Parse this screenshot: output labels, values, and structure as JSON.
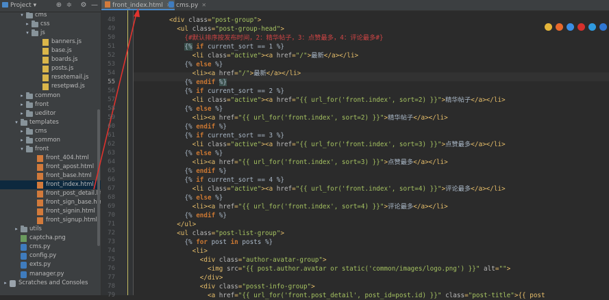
{
  "project_panel": {
    "title": "Project",
    "tree": [
      {
        "indent": 3,
        "arrow": "",
        "icon": "folder",
        "label": "static",
        "faded": true
      },
      {
        "indent": 3,
        "arrow": "▾",
        "icon": "folder",
        "label": "cms"
      },
      {
        "indent": 4,
        "arrow": "▸",
        "icon": "folder",
        "label": "css"
      },
      {
        "indent": 4,
        "arrow": "▾",
        "icon": "folder",
        "label": "js"
      },
      {
        "indent": 6,
        "arrow": "",
        "icon": "js",
        "label": "banners.js"
      },
      {
        "indent": 6,
        "arrow": "",
        "icon": "js",
        "label": "base.js"
      },
      {
        "indent": 6,
        "arrow": "",
        "icon": "js",
        "label": "boards.js"
      },
      {
        "indent": 6,
        "arrow": "",
        "icon": "js",
        "label": "posts.js"
      },
      {
        "indent": 6,
        "arrow": "",
        "icon": "js",
        "label": "resetemail.js"
      },
      {
        "indent": 6,
        "arrow": "",
        "icon": "js",
        "label": "resetpwd.js"
      },
      {
        "indent": 3,
        "arrow": "▸",
        "icon": "folder",
        "label": "common"
      },
      {
        "indent": 3,
        "arrow": "▸",
        "icon": "folder",
        "label": "front"
      },
      {
        "indent": 3,
        "arrow": "▸",
        "icon": "folder",
        "label": "ueditor"
      },
      {
        "indent": 2,
        "arrow": "▾",
        "icon": "folder",
        "label": "templates"
      },
      {
        "indent": 3,
        "arrow": "▸",
        "icon": "folder",
        "label": "cms"
      },
      {
        "indent": 3,
        "arrow": "▸",
        "icon": "folder",
        "label": "common"
      },
      {
        "indent": 3,
        "arrow": "▾",
        "icon": "folder",
        "label": "front"
      },
      {
        "indent": 5,
        "arrow": "",
        "icon": "html",
        "label": "front_404.html"
      },
      {
        "indent": 5,
        "arrow": "",
        "icon": "html",
        "label": "front_apost.html"
      },
      {
        "indent": 5,
        "arrow": "",
        "icon": "html",
        "label": "front_base.html"
      },
      {
        "indent": 5,
        "arrow": "",
        "icon": "html",
        "label": "front_index.html",
        "selected": true
      },
      {
        "indent": 5,
        "arrow": "",
        "icon": "html",
        "label": "front_post_detail.html"
      },
      {
        "indent": 5,
        "arrow": "",
        "icon": "html",
        "label": "front_sign_base.html"
      },
      {
        "indent": 5,
        "arrow": "",
        "icon": "html",
        "label": "front_signin.html"
      },
      {
        "indent": 5,
        "arrow": "",
        "icon": "html",
        "label": "front_signup.html"
      },
      {
        "indent": 2,
        "arrow": "▸",
        "icon": "folder",
        "label": "utils"
      },
      {
        "indent": 2,
        "arrow": "",
        "icon": "png",
        "label": "captcha.png"
      },
      {
        "indent": 2,
        "arrow": "",
        "icon": "py",
        "label": "cms.py"
      },
      {
        "indent": 2,
        "arrow": "",
        "icon": "py",
        "label": "config.py"
      },
      {
        "indent": 2,
        "arrow": "",
        "icon": "py",
        "label": "exts.py"
      },
      {
        "indent": 2,
        "arrow": "",
        "icon": "py",
        "label": "manager.py"
      },
      {
        "indent": 0,
        "arrow": "▸",
        "icon": "lib",
        "label": "Scratches and Consoles"
      }
    ]
  },
  "tabs": [
    {
      "label": "front_index.html",
      "icon": "html",
      "active": true
    },
    {
      "label": "cms.py",
      "icon": "py",
      "active": false
    }
  ],
  "editor": {
    "current_line": 55,
    "lines": [
      {
        "n": 48,
        "indent": 4,
        "tokens": [
          [
            "t",
            "<div "
          ],
          [
            "a",
            "class"
          ],
          [
            "t",
            "="
          ],
          [
            "s",
            "\"post-group\""
          ],
          [
            "t",
            ">"
          ]
        ]
      },
      {
        "n": 49,
        "indent": 6,
        "tokens": [
          [
            "t",
            "<ul "
          ],
          [
            "a",
            "class"
          ],
          [
            "t",
            "="
          ],
          [
            "s",
            "\"post-group-head\""
          ],
          [
            "t",
            ">"
          ]
        ]
      },
      {
        "n": 50,
        "indent": 8,
        "tokens": [
          [
            "c",
            "{#默认排序按发布时间，2：精华帖子，3：点赞最多，4：评论最多#}"
          ]
        ]
      },
      {
        "n": 51,
        "indent": 8,
        "tokens": [
          [
            "hl",
            "{%"
          ],
          [
            "p",
            " "
          ],
          [
            "k",
            "if"
          ],
          [
            "p",
            " current_sort == 1 %}"
          ]
        ]
      },
      {
        "n": 52,
        "indent": 10,
        "tokens": [
          [
            "t",
            "<li "
          ],
          [
            "a",
            "class"
          ],
          [
            "t",
            "="
          ],
          [
            "s",
            "\"active\""
          ],
          [
            "t",
            "><a "
          ],
          [
            "a",
            "href"
          ],
          [
            "t",
            "="
          ],
          [
            "s",
            "\"/\""
          ],
          [
            "t",
            ">"
          ],
          [
            "p",
            "最新"
          ],
          [
            "t",
            "</a></li>"
          ]
        ]
      },
      {
        "n": 53,
        "indent": 8,
        "tokens": [
          [
            "p",
            "{% "
          ],
          [
            "k",
            "else"
          ],
          [
            "p",
            " %}"
          ]
        ]
      },
      {
        "n": 54,
        "indent": 10,
        "tokens": [
          [
            "t",
            "<li><a "
          ],
          [
            "a",
            "href"
          ],
          [
            "t",
            "="
          ],
          [
            "s",
            "\"/\""
          ],
          [
            "t",
            ">"
          ],
          [
            "p",
            "最新"
          ],
          [
            "t",
            "</a></li>"
          ]
        ]
      },
      {
        "n": 55,
        "indent": 8,
        "tokens": [
          [
            "p",
            "{% "
          ],
          [
            "k",
            "endif"
          ],
          [
            "p",
            " "
          ],
          [
            "hl",
            "%}"
          ]
        ]
      },
      {
        "n": 56,
        "indent": 8,
        "tokens": [
          [
            "p",
            "{% "
          ],
          [
            "k",
            "if"
          ],
          [
            "p",
            " current_sort == 2 %}"
          ]
        ]
      },
      {
        "n": 57,
        "indent": 10,
        "tokens": [
          [
            "t",
            "<li "
          ],
          [
            "a",
            "class"
          ],
          [
            "t",
            "="
          ],
          [
            "s",
            "\"active\""
          ],
          [
            "t",
            "><a "
          ],
          [
            "a",
            "href"
          ],
          [
            "t",
            "="
          ],
          [
            "s",
            "\"{{ url_for('front.index', sort=2) }}\""
          ],
          [
            "t",
            ">"
          ],
          [
            "p",
            "精华帖子"
          ],
          [
            "t",
            "</a></li>"
          ]
        ]
      },
      {
        "n": 58,
        "indent": 8,
        "tokens": [
          [
            "p",
            "{% "
          ],
          [
            "k",
            "else"
          ],
          [
            "p",
            " %}"
          ]
        ]
      },
      {
        "n": 59,
        "indent": 10,
        "tokens": [
          [
            "t",
            "<li><a "
          ],
          [
            "a",
            "href"
          ],
          [
            "t",
            "="
          ],
          [
            "s",
            "\"{{ url_for('front.index', sort=2) }}\""
          ],
          [
            "t",
            ">"
          ],
          [
            "p",
            "精华帖子"
          ],
          [
            "t",
            "</a></li>"
          ]
        ]
      },
      {
        "n": 60,
        "indent": 8,
        "tokens": [
          [
            "p",
            "{% "
          ],
          [
            "k",
            "endif"
          ],
          [
            "p",
            " %}"
          ]
        ]
      },
      {
        "n": 61,
        "indent": 8,
        "tokens": [
          [
            "p",
            "{% "
          ],
          [
            "k",
            "if"
          ],
          [
            "p",
            " current_sort == 3 %}"
          ]
        ]
      },
      {
        "n": 62,
        "indent": 10,
        "tokens": [
          [
            "t",
            "<li "
          ],
          [
            "a",
            "class"
          ],
          [
            "t",
            "="
          ],
          [
            "s",
            "\"active\""
          ],
          [
            "t",
            "><a "
          ],
          [
            "a",
            "href"
          ],
          [
            "t",
            "="
          ],
          [
            "s",
            "\"{{ url_for('front.index', sort=3) }}\""
          ],
          [
            "t",
            ">"
          ],
          [
            "p",
            "点赞最多"
          ],
          [
            "t",
            "</a></li>"
          ]
        ]
      },
      {
        "n": 63,
        "indent": 8,
        "tokens": [
          [
            "p",
            "{% "
          ],
          [
            "k",
            "else"
          ],
          [
            "p",
            " %}"
          ]
        ]
      },
      {
        "n": 64,
        "indent": 10,
        "tokens": [
          [
            "t",
            "<li><a "
          ],
          [
            "a",
            "href"
          ],
          [
            "t",
            "="
          ],
          [
            "s",
            "\"{{ url_for('front.index', sort=3) }}\""
          ],
          [
            "t",
            ">"
          ],
          [
            "p",
            "点赞最多"
          ],
          [
            "t",
            "</a></li>"
          ]
        ]
      },
      {
        "n": 65,
        "indent": 8,
        "tokens": [
          [
            "p",
            "{% "
          ],
          [
            "k",
            "endif"
          ],
          [
            "p",
            " %}"
          ]
        ]
      },
      {
        "n": 66,
        "indent": 8,
        "tokens": [
          [
            "p",
            "{% "
          ],
          [
            "k",
            "if"
          ],
          [
            "p",
            " current_sort == 4 %}"
          ]
        ]
      },
      {
        "n": 67,
        "indent": 10,
        "tokens": [
          [
            "t",
            "<li "
          ],
          [
            "a",
            "class"
          ],
          [
            "t",
            "="
          ],
          [
            "s",
            "\"active\""
          ],
          [
            "t",
            "><a "
          ],
          [
            "a",
            "href"
          ],
          [
            "t",
            "="
          ],
          [
            "s",
            "\"{{ url_for('front.index', sort=4) }}\""
          ],
          [
            "t",
            ">"
          ],
          [
            "p",
            "评论最多"
          ],
          [
            "t",
            "</a></li>"
          ]
        ]
      },
      {
        "n": 68,
        "indent": 8,
        "tokens": [
          [
            "p",
            "{% "
          ],
          [
            "k",
            "else"
          ],
          [
            "p",
            " %}"
          ]
        ]
      },
      {
        "n": 69,
        "indent": 10,
        "tokens": [
          [
            "t",
            "<li><a "
          ],
          [
            "a",
            "href"
          ],
          [
            "t",
            "="
          ],
          [
            "s",
            "\"{{ url_for('front.index', sort=4) }}\""
          ],
          [
            "t",
            ">"
          ],
          [
            "p",
            "评论最多"
          ],
          [
            "t",
            "</a></li>"
          ]
        ]
      },
      {
        "n": 70,
        "indent": 8,
        "tokens": [
          [
            "p",
            "{% "
          ],
          [
            "k",
            "endif"
          ],
          [
            "p",
            " %}"
          ]
        ]
      },
      {
        "n": 71,
        "indent": 6,
        "tokens": [
          [
            "t",
            "</ul>"
          ]
        ]
      },
      {
        "n": 72,
        "indent": 6,
        "tokens": [
          [
            "t",
            "<ul "
          ],
          [
            "a",
            "class"
          ],
          [
            "t",
            "="
          ],
          [
            "s",
            "\"post-list-group\""
          ],
          [
            "t",
            ">"
          ]
        ]
      },
      {
        "n": 73,
        "indent": 8,
        "tokens": [
          [
            "p",
            "{% "
          ],
          [
            "k",
            "for"
          ],
          [
            "p",
            " post "
          ],
          [
            "k",
            "in"
          ],
          [
            "p",
            " posts %}"
          ]
        ]
      },
      {
        "n": 74,
        "indent": 10,
        "tokens": [
          [
            "t",
            "<li>"
          ]
        ]
      },
      {
        "n": 75,
        "indent": 12,
        "tokens": [
          [
            "t",
            "<div "
          ],
          [
            "a",
            "class"
          ],
          [
            "t",
            "="
          ],
          [
            "s",
            "\"author-avatar-group\""
          ],
          [
            "t",
            ">"
          ]
        ]
      },
      {
        "n": 76,
        "indent": 14,
        "tokens": [
          [
            "t",
            "<img "
          ],
          [
            "a",
            "src"
          ],
          [
            "t",
            "="
          ],
          [
            "s",
            "\"{{ post.author.avatar or static('common/images/logo.png') }}\""
          ],
          [
            "t",
            " "
          ],
          [
            "a",
            "alt"
          ],
          [
            "t",
            "="
          ],
          [
            "s",
            "\"\""
          ],
          [
            "t",
            ">"
          ]
        ]
      },
      {
        "n": 77,
        "indent": 12,
        "tokens": [
          [
            "t",
            "</div>"
          ]
        ]
      },
      {
        "n": 78,
        "indent": 12,
        "tokens": [
          [
            "t",
            "<div "
          ],
          [
            "a",
            "class"
          ],
          [
            "t",
            "="
          ],
          [
            "s",
            "\"posst-info-group\""
          ],
          [
            "t",
            ">"
          ]
        ]
      },
      {
        "n": 79,
        "indent": 14,
        "tokens": [
          [
            "t",
            "<a "
          ],
          [
            "a",
            "href"
          ],
          [
            "t",
            "="
          ],
          [
            "s",
            "\"{{ url_for('front.post_detail', post_id=post.id) }}\""
          ],
          [
            "t",
            " "
          ],
          [
            "a",
            "class"
          ],
          [
            "t",
            "="
          ],
          [
            "s",
            "\"post-title\""
          ],
          [
            "t",
            ">{{ post"
          ]
        ]
      }
    ]
  },
  "browser_icons": [
    {
      "name": "chrome-icon",
      "color": "#e4b53a"
    },
    {
      "name": "firefox-icon",
      "color": "#e8692c"
    },
    {
      "name": "safari-icon",
      "color": "#3a8ee6"
    },
    {
      "name": "opera-icon",
      "color": "#d4302c"
    },
    {
      "name": "ie-icon",
      "color": "#2f9ae0"
    },
    {
      "name": "edge-icon",
      "color": "#2f76d2"
    }
  ],
  "colors": {
    "accent": "#4a88c7",
    "annotation_arrow": "#e0332e"
  }
}
